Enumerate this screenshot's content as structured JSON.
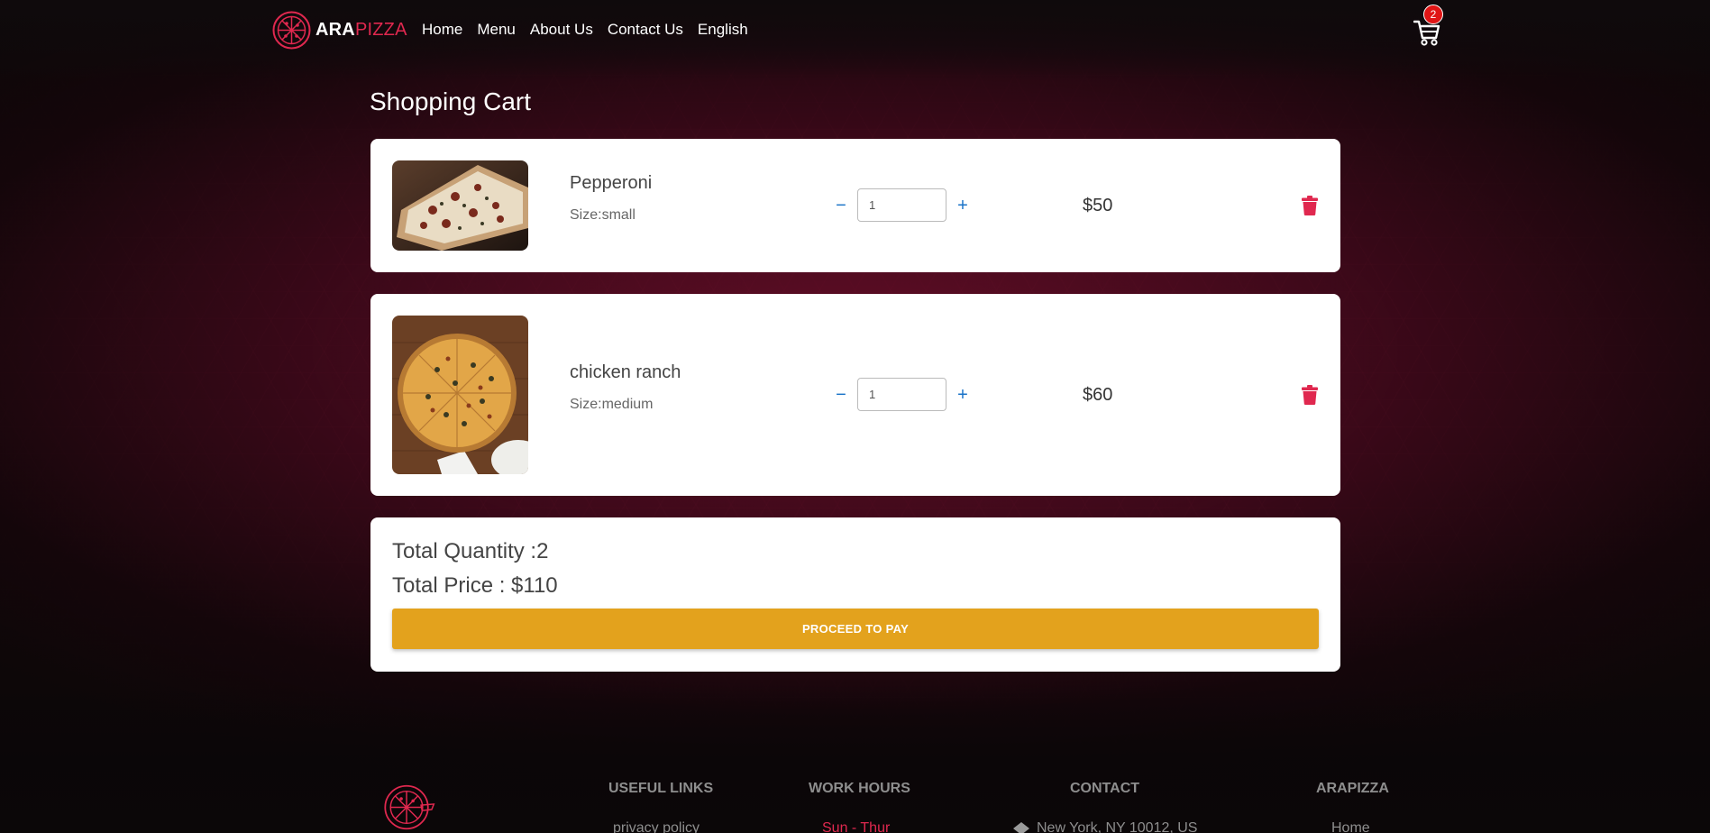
{
  "nav": {
    "brand_a": "ARA",
    "brand_b": "PIZZA",
    "links": [
      "Home",
      "Menu",
      "About Us",
      "Contact Us",
      "English"
    ],
    "cart_count": "2"
  },
  "page_title": "Shopping Cart",
  "items": [
    {
      "name": "Pepperoni",
      "size_label": "Size:",
      "size": "small",
      "quantity": "1",
      "price": "$50",
      "decrement": "−",
      "increment": "+"
    },
    {
      "name": "chicken ranch",
      "size_label": "Size:",
      "size": "medium",
      "quantity": "1",
      "price": "$60",
      "decrement": "−",
      "increment": "+"
    }
  ],
  "summary": {
    "total_quantity": "Total Quantity :2",
    "total_price": "Total Price : $110",
    "pay_label": "PROCEED TO PAY"
  },
  "footer": {
    "useful_links": "USEFUL LINKS",
    "work_hours": "WORK HOURS",
    "contact": "CONTACT",
    "brand": "ARAPIZZA",
    "privacy": "privacy policy",
    "hours": "Sun - Thur",
    "address": "New York, NY 10012, US",
    "home": "Home"
  },
  "colors": {
    "accent": "#e0284f",
    "pay_button": "#e3a21d",
    "qty_control": "#1a73c8",
    "badge": "#e01515"
  }
}
